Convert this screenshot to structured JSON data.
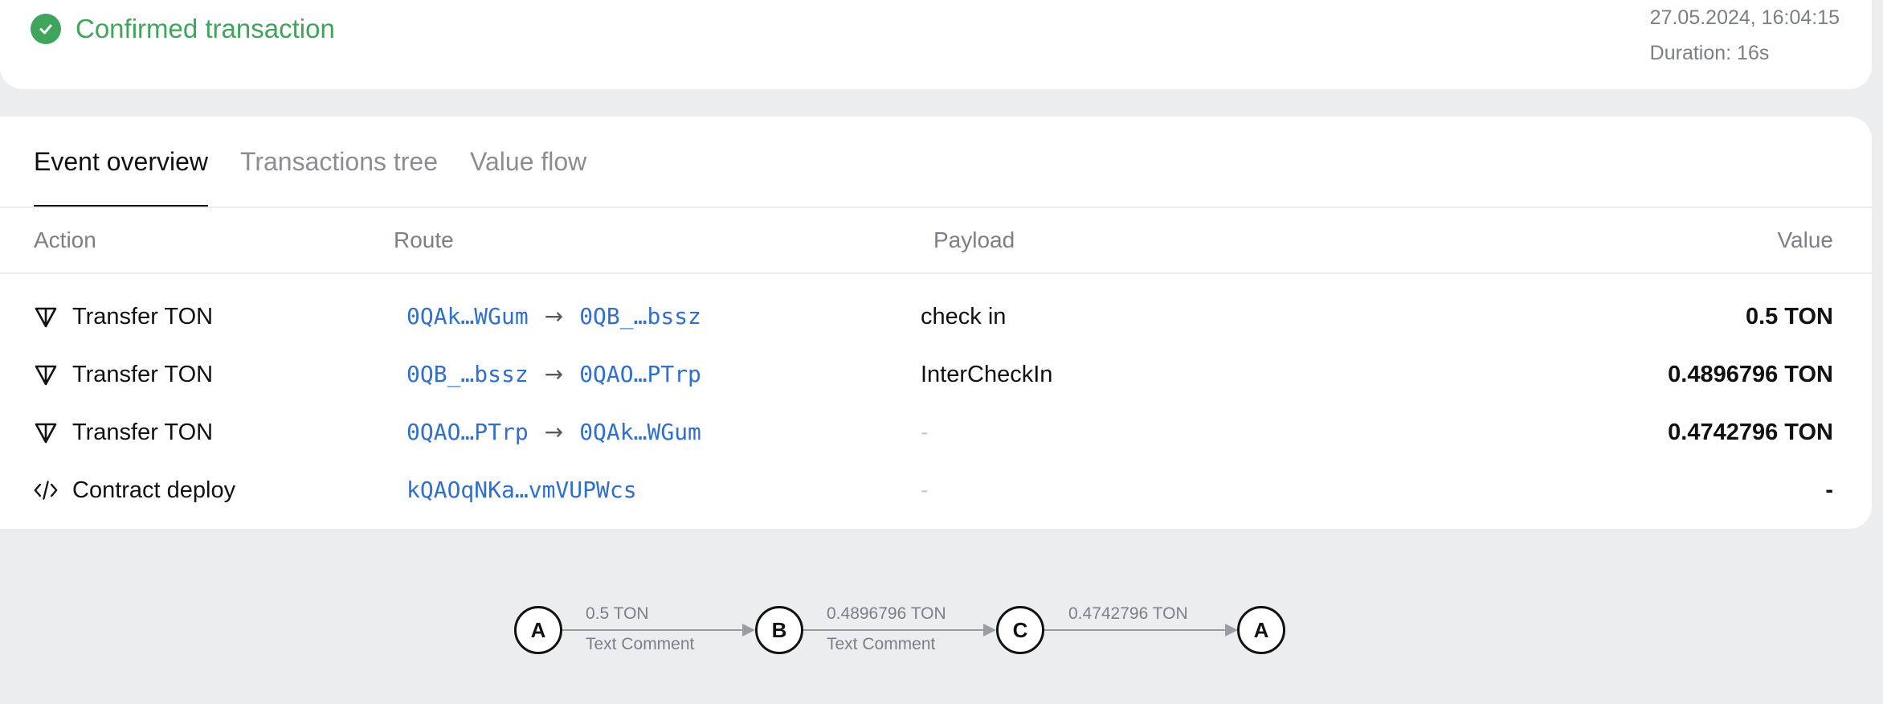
{
  "status": {
    "label": "Confirmed transaction",
    "datetime": "27.05.2024, 16:04:15",
    "duration": "Duration: 16s",
    "color": "#3fa55c"
  },
  "tabs": [
    {
      "label": "Event overview",
      "active": true
    },
    {
      "label": "Transactions tree",
      "active": false
    },
    {
      "label": "Value flow",
      "active": false
    }
  ],
  "table": {
    "headers": {
      "action": "Action",
      "route": "Route",
      "payload": "Payload",
      "value": "Value"
    },
    "rows": [
      {
        "icon": "ton-diamond-icon",
        "action": "Transfer TON",
        "from": "0QAk…WGum",
        "arrow": "→",
        "to": "0QB_…bssz",
        "payload": "check in",
        "value": "0.5 TON"
      },
      {
        "icon": "ton-diamond-icon",
        "action": "Transfer TON",
        "from": "0QB_…bssz",
        "arrow": "→",
        "to": "0QAO…PTrp",
        "payload": "InterCheckIn",
        "value": "0.4896796 TON"
      },
      {
        "icon": "ton-diamond-icon",
        "action": "Transfer TON",
        "from": "0QAO…PTrp",
        "arrow": "→",
        "to": "0QAk…WGum",
        "payload": "-",
        "value": "0.4742796 TON"
      },
      {
        "icon": "code-icon",
        "action": "Contract deploy",
        "from": "kQAOqNKa…vmVUPWcs",
        "arrow": "",
        "to": "",
        "payload": "-",
        "value": "-"
      }
    ]
  },
  "flow": {
    "nodes": [
      "A",
      "B",
      "C",
      "A"
    ],
    "edges": [
      {
        "amount": "0.5 TON",
        "comment": "Text Comment"
      },
      {
        "amount": "0.4896796 TON",
        "comment": "Text Comment"
      },
      {
        "amount": "0.4742796 TON",
        "comment": ""
      }
    ]
  },
  "colors": {
    "link": "#2f6fd0",
    "muted": "#7b7f86",
    "background": "#ecedef"
  }
}
